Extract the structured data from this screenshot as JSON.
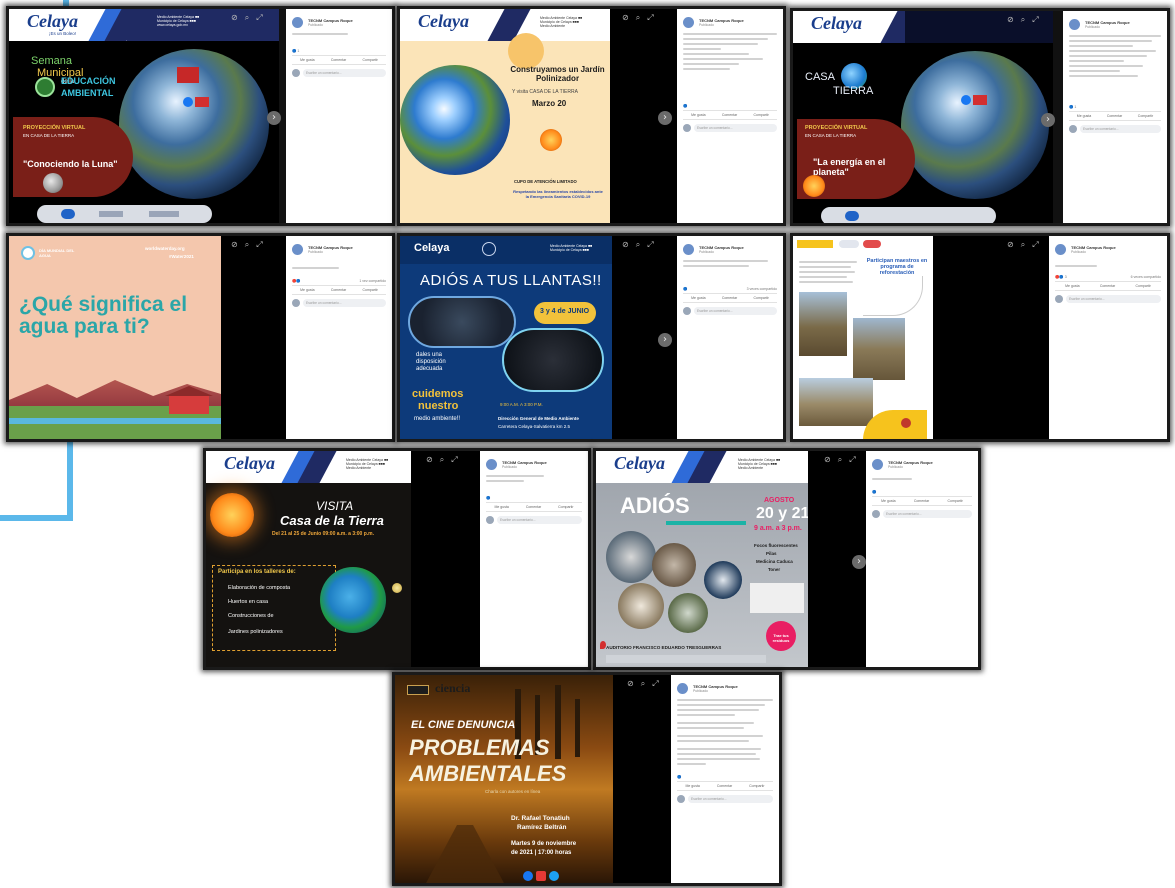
{
  "colors": {
    "accent_line": "#5bb8ea",
    "celaya_navy": "#1a3e8c",
    "facebook_white": "#ffffff",
    "poster_pink_bg": "#f4c7ad",
    "agua_teal": "#2ba6a8",
    "llantas_blue": "#0d3a7a"
  },
  "facebook_post": {
    "page_name": "TECNM Campus Roque",
    "date": "Publicado",
    "like": "Me gusta",
    "comment": "Comentar",
    "share": "Compartir",
    "comment_placeholder": "Escribe un comentario..."
  },
  "panels": {
    "p1": {
      "celaya": "Celaya",
      "tagline": "¡Es un Boleo!",
      "semana": "Semana",
      "municipal": "Municipal",
      "de_la": "de la",
      "educacion": "EDUCACIÓN",
      "ambiental": "AMBIENTAL",
      "proyeccion": "PROYECCIÓN VIRTUAL",
      "proyeccion_sub": "EN CASA DE LA TIERRA",
      "title": "\"Conociendo la Luna\""
    },
    "p2": {
      "celaya": "Celaya",
      "title": "Construyamos un Jardín Polinizador",
      "place": "Y visita CASA DE LA TIERRA",
      "date": "Marzo 20",
      "cupo": "CUPO DE ATENCIÓN LIMITADO",
      "note": "Respetando las lineamientos establecidos ante la Emergencia Sanitaria COVID-19"
    },
    "p3": {
      "celaya": "Celaya",
      "casa": "CASA",
      "tierra": "TIERRA",
      "proyeccion": "PROYECCIÓN VIRTUAL",
      "proyeccion_sub": "EN CASA DE LA TIERRA",
      "title": "\"La energía en el planeta\""
    },
    "p4": {
      "org": "DÍA MUNDIAL DEL AGUA",
      "site": "worldwaterday.org",
      "hashtag": "#Water2021",
      "question": "¿Qué significa el agua para ti?"
    },
    "p5": {
      "celaya": "Celaya",
      "title": "ADIÓS A TUS LLANTAS!!",
      "dates": "3 y 4 de JUNIO",
      "slogan1": "dales una disposición adecuada",
      "slogan2": "cuidemos",
      "slogan3": "nuestro",
      "slogan4": "medio ambiente!!",
      "horario": "9:00 A.M. A 3:00 P.M.",
      "place": "Dirección General de Medio Ambiente",
      "address": "Carretera Celaya-Salvatierra km 2.5"
    },
    "p6": {
      "title": "Participan maestros en programa de reforestación"
    },
    "p7": {
      "celaya": "Celaya",
      "visita": "VISITA",
      "casa": "Casa de la Tierra",
      "dates": "Del 21 al 25 de Junio  09:00 a.m. a 3:00 p.m.",
      "participa": "Participa en los talleres de:",
      "t1": "Elaboración de composta",
      "t2": "Huertos en casa",
      "t3": "Construcciones de",
      "t4": "Jardines polinizadores"
    },
    "p8": {
      "celaya": "Celaya",
      "adios": "ADIÓS",
      "mes": "AGOSTO",
      "dias": "20 y 21",
      "hora": "9 a.m. a 3 p.m.",
      "items": [
        "Focos fluorescentes",
        "Pilas",
        "Medicina Caduca",
        "Toner"
      ],
      "auditorio": "AUDITORIO FRANCISCO EDUARDO TRESGUERRAS",
      "badge": "Trae tus residuos"
    },
    "p9": {
      "logo": "ciencia",
      "line1": "EL CINE DENUNCIA",
      "line2": "PROBLEMAS",
      "line3": "AMBIENTALES",
      "sub": "Charla con autores en línea",
      "speaker1": "Dr. Rafael Tonatiuh",
      "speaker2": "Ramírez Beltrán",
      "when1": "Martes 9 de noviembre",
      "when2": "de 2021 | 17:00 horas"
    }
  }
}
